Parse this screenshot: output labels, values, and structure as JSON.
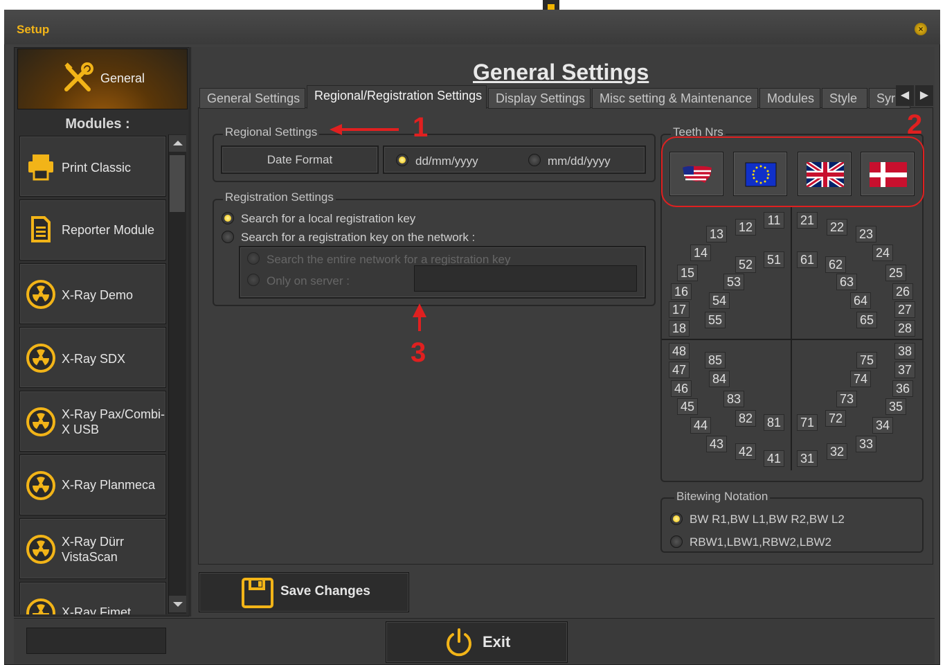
{
  "window": {
    "title": "Setup"
  },
  "sidebar": {
    "general_label": "General",
    "modules_heading": "Modules :",
    "modules": [
      {
        "label": "Print Classic",
        "icon": "printer-icon"
      },
      {
        "label": "Reporter Module",
        "icon": "document-icon"
      },
      {
        "label": "X-Ray Demo",
        "icon": "radiation-icon"
      },
      {
        "label": "X-Ray SDX",
        "icon": "radiation-icon"
      },
      {
        "label": "X-Ray Pax/Combi-X USB",
        "icon": "radiation-icon"
      },
      {
        "label": "X-Ray Planmeca",
        "icon": "radiation-icon"
      },
      {
        "label": "X-Ray Dürr VistaScan",
        "icon": "radiation-icon"
      },
      {
        "label": "X-Ray Fimet",
        "icon": "radiation-icon"
      }
    ]
  },
  "main": {
    "page_title": "General Settings",
    "tabs": [
      {
        "label": "General Settings"
      },
      {
        "label": "Regional/Registration Settings",
        "active": true
      },
      {
        "label": "Display Settings"
      },
      {
        "label": "Misc setting & Maintenance"
      },
      {
        "label": "Modules"
      },
      {
        "label": "Style"
      },
      {
        "label": "Syr"
      }
    ]
  },
  "regional": {
    "legend": "Regional Settings",
    "date_format_label": "Date Format",
    "option_dmy": "dd/mm/yyyy",
    "option_mdy": "mm/dd/yyyy",
    "selected": "dd/mm/yyyy"
  },
  "registration": {
    "legend": "Registration Settings",
    "option_local": "Search for a local registration key",
    "option_network": "Search for a registration key on the network :",
    "sub_entire": "Search the entire network for a registration key",
    "sub_server": "Only on server :",
    "server_value": ""
  },
  "teeth": {
    "legend": "Teeth Nrs",
    "flags": [
      "usa-flag-icon",
      "eu-flag-icon",
      "uk-flag-icon",
      "denmark-flag-icon"
    ],
    "numbers": [
      "11",
      "12",
      "13",
      "14",
      "15",
      "16",
      "17",
      "18",
      "21",
      "22",
      "23",
      "24",
      "25",
      "26",
      "27",
      "28",
      "31",
      "32",
      "33",
      "34",
      "35",
      "36",
      "37",
      "38",
      "41",
      "42",
      "43",
      "44",
      "45",
      "46",
      "47",
      "48",
      "51",
      "52",
      "53",
      "54",
      "55",
      "61",
      "62",
      "63",
      "64",
      "65",
      "71",
      "72",
      "73",
      "74",
      "75",
      "81",
      "82",
      "83",
      "84",
      "85"
    ]
  },
  "bitewing": {
    "legend": "Bitewing Notation",
    "option_a": "BW R1,BW L1,BW R2,BW L2",
    "option_b": "RBW1,LBW1,RBW2,LBW2",
    "selected": "BW R1,BW L1,BW R2,BW L2"
  },
  "annotations": {
    "one": "1",
    "two": "2",
    "three": "3"
  },
  "footer": {
    "save_label": "Save Changes",
    "exit_label": "Exit",
    "status_value": ""
  },
  "colors": {
    "accent": "#f2b418",
    "annotation": "#e02020",
    "background": "#3d3d3d"
  }
}
